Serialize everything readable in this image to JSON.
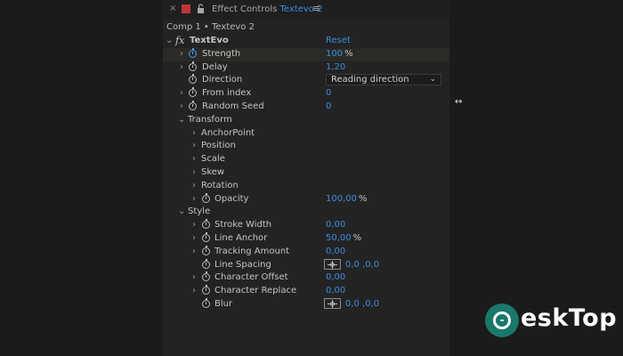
{
  "tab": {
    "close": "×",
    "title_prefix": "Effect Controls",
    "layer_name": "Textevo 2",
    "menu": "≡"
  },
  "comp_path": "Comp 1 • Textevo 2",
  "effect": {
    "fx": "fx",
    "name": "TextEvo",
    "reset": "Reset"
  },
  "params": {
    "strength": {
      "label": "Strength",
      "value": "100",
      "unit": "%"
    },
    "delay": {
      "label": "Delay",
      "value": "1,20"
    },
    "direction": {
      "label": "Direction",
      "value": "Reading direction"
    },
    "from_index": {
      "label": "From index",
      "value": "0"
    },
    "random_seed": {
      "label": "Random Seed",
      "value": "0"
    }
  },
  "transform": {
    "label": "Transform",
    "anchor_point": "AnchorPoint",
    "position": "Position",
    "scale": "Scale",
    "skew": "Skew",
    "rotation": "Rotation",
    "opacity": {
      "label": "Opacity",
      "value": "100,00",
      "unit": "%"
    }
  },
  "style": {
    "label": "Style",
    "stroke_width": {
      "label": "Stroke Width",
      "value": "0,00"
    },
    "line_anchor": {
      "label": "Line Anchor",
      "value": "50,00",
      "unit": "%"
    },
    "tracking_amount": {
      "label": "Tracking Amount",
      "value": "0,00"
    },
    "line_spacing": {
      "label": "Line Spacing",
      "value": "0,0 ,0,0"
    },
    "character_offset": {
      "label": "Character Offset",
      "value": "0,00"
    },
    "character_replace": {
      "label": "Character Replace",
      "value": "0,00"
    },
    "blur": {
      "label": "Blur",
      "value": "0,0 ,0,0"
    }
  },
  "watermark": {
    "text": "eskTop"
  },
  "colors": {
    "accent_value": "#3b8ee0",
    "panel_bg": "#232323",
    "page_bg": "#1b1b1b",
    "swatch": "#c0353a"
  }
}
